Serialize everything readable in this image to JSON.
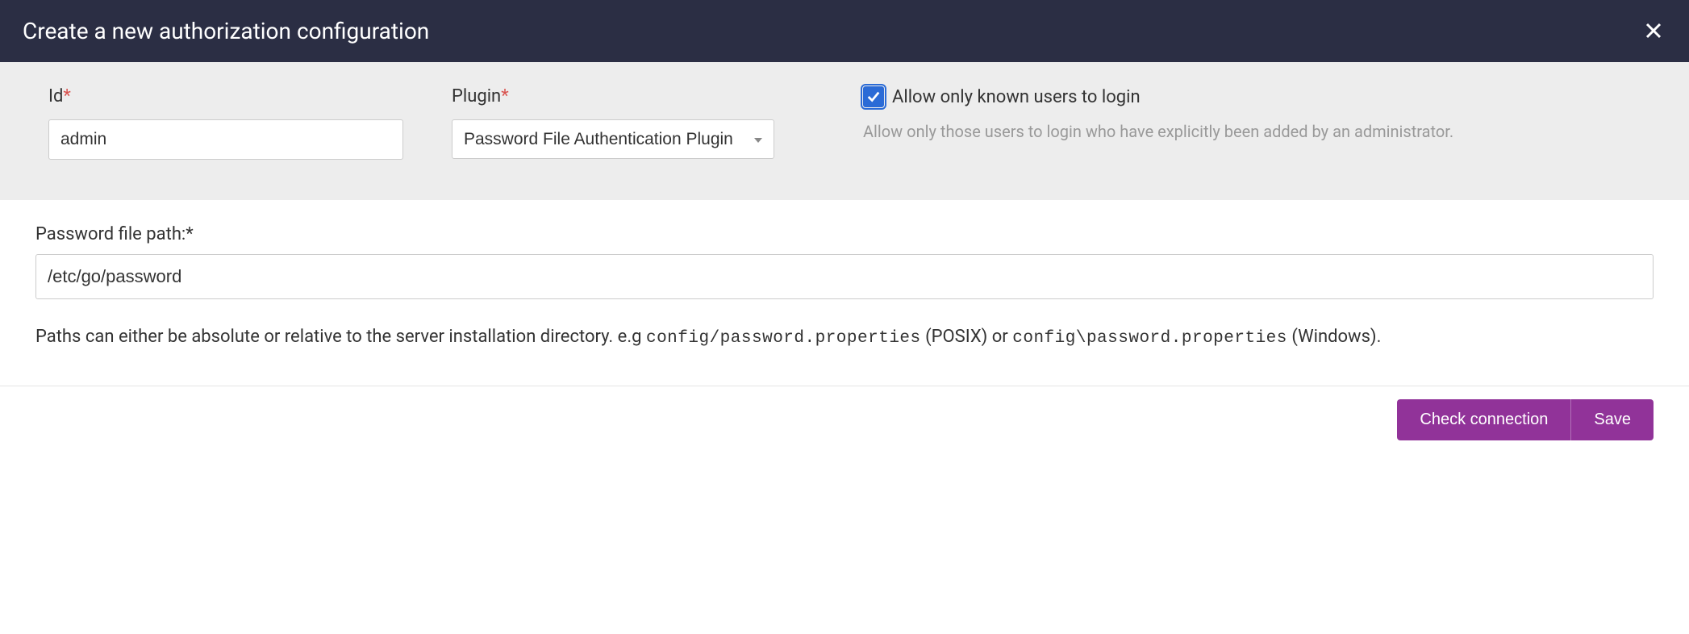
{
  "header": {
    "title": "Create a new authorization configuration"
  },
  "form": {
    "id": {
      "label": "Id",
      "required": "*",
      "value": "admin"
    },
    "plugin": {
      "label": "Plugin",
      "required": "*",
      "selected": "Password File Authentication Plugin"
    },
    "allow_known": {
      "label": "Allow only known users to login",
      "checked": true,
      "help": "Allow only those users to login who have explicitly been added by an administrator."
    },
    "password_path": {
      "label": "Password file path:*",
      "value": "/etc/go/password",
      "help_prefix": "Paths can either be absolute or relative to the server installation directory. e.g ",
      "help_code1": "config/password.properties",
      "help_mid1": " (POSIX) or ",
      "help_code2": "config\\password.properties",
      "help_suffix": " (Windows)."
    }
  },
  "footer": {
    "check": "Check connection",
    "save": "Save"
  }
}
